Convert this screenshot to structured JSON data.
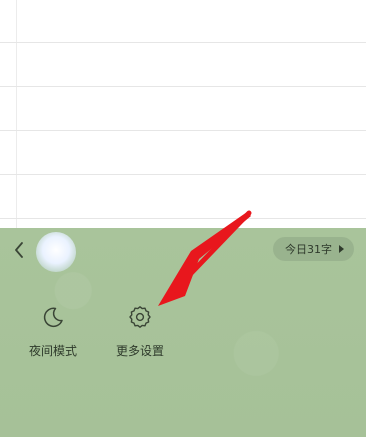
{
  "panel": {
    "back_icon": "chevron-left-icon",
    "today_count_label": "今日31字",
    "actions": [
      {
        "label": "夜间模式",
        "icon": "moon-icon"
      },
      {
        "label": "更多设置",
        "icon": "gear-icon"
      }
    ]
  },
  "colors": {
    "panel_background": "#a8c39a",
    "text": "#2e3a2b",
    "annotation_arrow": "#e8171d"
  }
}
